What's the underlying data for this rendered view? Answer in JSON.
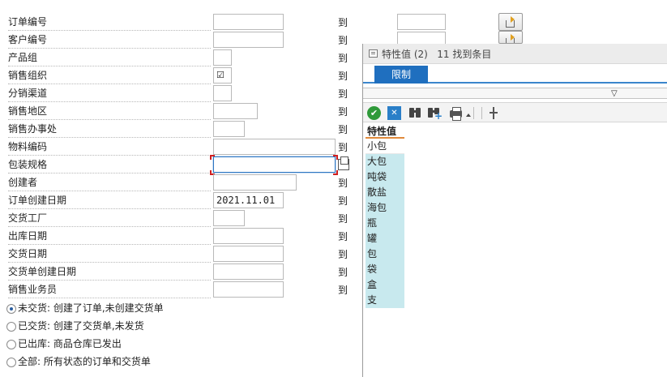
{
  "selection_screen": {
    "to_label": "到",
    "fields": [
      {
        "label": "订单编号",
        "value": "",
        "has_to": true
      },
      {
        "label": "客户编号",
        "value": "",
        "has_to": true
      },
      {
        "label": "产品组",
        "value": "",
        "has_to": true
      },
      {
        "label": "销售组织",
        "value": "☑",
        "has_to": true,
        "checked": true
      },
      {
        "label": "分销渠道",
        "value": "",
        "has_to": true
      },
      {
        "label": "销售地区",
        "value": "",
        "has_to": true
      },
      {
        "label": "销售办事处",
        "value": "",
        "has_to": true
      },
      {
        "label": "物料编码",
        "value": "",
        "has_to": true
      },
      {
        "label": "包装规格",
        "value": "",
        "has_to": false,
        "focused": true
      },
      {
        "label": "创建者",
        "value": "",
        "has_to": true
      },
      {
        "label": "订单创建日期",
        "value": "2021.11.01",
        "has_to": true
      },
      {
        "label": "交货工厂",
        "value": "",
        "has_to": true
      },
      {
        "label": "出库日期",
        "value": "",
        "has_to": true
      },
      {
        "label": "交货日期",
        "value": "",
        "has_to": true
      },
      {
        "label": "交货单创建日期",
        "value": "",
        "has_to": true
      },
      {
        "label": "销售业务员",
        "value": "",
        "has_to": true
      }
    ],
    "radios": [
      {
        "label": "未交货: 创建了订单,未创建交货单",
        "selected": true
      },
      {
        "label": "已交货: 创建了交货单,未发货",
        "selected": false
      },
      {
        "label": "已出库: 商品仓库已发出",
        "selected": false
      },
      {
        "label": "全部: 所有状态的订单和交货单",
        "selected": false
      }
    ]
  },
  "value_help": {
    "title": "特性值 (2)",
    "hits": "11 找到条目",
    "tab_label": "限制",
    "column_header": "特性值",
    "items": [
      "小包",
      "大包",
      "吨袋",
      "散盐",
      "海包",
      "瓶",
      "罐",
      "包",
      "袋",
      "盒",
      "支"
    ],
    "toolbar_icons": [
      "check-icon",
      "cancel-icon",
      "binoculars-icon",
      "binoculars-plus-icon",
      "printer-icon",
      "column-icon"
    ],
    "colors": {
      "tab": "#1f6fbf",
      "list_bg": "#c8e9ee",
      "ok": "#2f9a3a",
      "header_underline": "#e08a3c"
    }
  }
}
